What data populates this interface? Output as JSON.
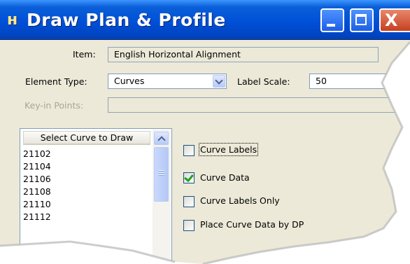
{
  "window": {
    "title": "Draw Plan & Profile",
    "app_icon_glyph": "ʜ",
    "controls": {
      "minimize_icon": "minimize-icon",
      "maximize_icon": "maximize-icon",
      "close_icon": "close-icon",
      "close_glyph": "X"
    }
  },
  "form": {
    "item_label": "Item:",
    "item_value": "English Horizontal Alignment",
    "element_type_label": "Element Type:",
    "element_type_value": "Curves",
    "label_scale_label": "Label Scale:",
    "label_scale_value": "50",
    "keyin_points_label": "Key-in Points:",
    "keyin_points_value": ""
  },
  "curve_list": {
    "header": "Select Curve to Draw",
    "items": [
      "21102",
      "21104",
      "21106",
      "21108",
      "21110",
      "21112"
    ]
  },
  "options": [
    {
      "label": "Curve Labels",
      "checked": false
    },
    {
      "label": "Curve Data",
      "checked": true
    },
    {
      "label": "Curve Labels Only",
      "checked": false
    },
    {
      "label": "Place Curve Data by DP",
      "checked": false
    }
  ],
  "colors": {
    "titlebar": "#0050d8",
    "dialog_bg": "#ece9d8",
    "check_mark": "#21a121",
    "close_button": "#c5401f"
  }
}
